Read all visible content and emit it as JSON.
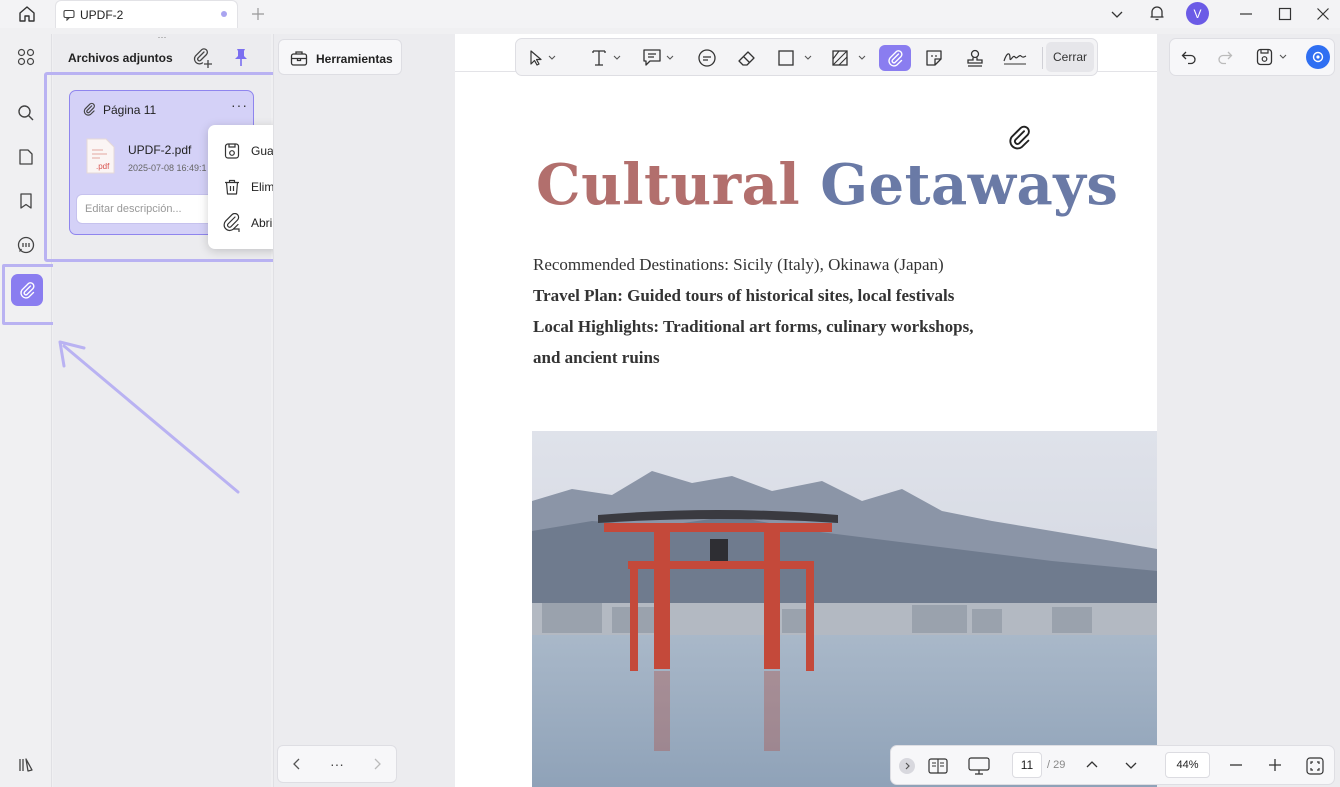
{
  "titlebar": {
    "tab_title": "UPDF-2",
    "avatar_letter": "V"
  },
  "attachments_panel": {
    "title": "Archivos adjuntos",
    "card": {
      "page_label": "Página 11",
      "file_name": "UPDF-2.pdf",
      "file_date": "2025-07-08 16:49:1",
      "file_type": ".pdf",
      "description_placeholder": "Editar descripción..."
    },
    "context_menu": [
      {
        "label": "Guardar archivo adjunto...",
        "icon": "save-icon"
      },
      {
        "label": "Eliminar archivo adjunto",
        "icon": "trash-icon"
      },
      {
        "label": "Abrir archivo adjunto",
        "icon": "open-attachment-icon"
      }
    ]
  },
  "tools": {
    "label": "Herramientas",
    "pager_dots": "···"
  },
  "annotation_toolbar": {
    "close_label": "Cerrar",
    "active_tool": "attachment"
  },
  "document": {
    "title_word1": "Cultural",
    "title_word2": "Getaways",
    "line1": "Recommended Destinations: Sicily (Italy), Okinawa (Japan)",
    "line2": "Travel Plan: Guided tours of historical sites, local festivals",
    "line3": "Local Highlights: Traditional art forms, culinary workshops,",
    "line4": "and ancient ruins"
  },
  "navigation": {
    "current_page": "11",
    "total_pages": "/ 29",
    "zoom": "44%"
  },
  "colors": {
    "accent": "#8a7df0",
    "highlight": "#b9b2f2",
    "title_red": "#b26f6d",
    "title_blue": "#6a7aa6"
  }
}
